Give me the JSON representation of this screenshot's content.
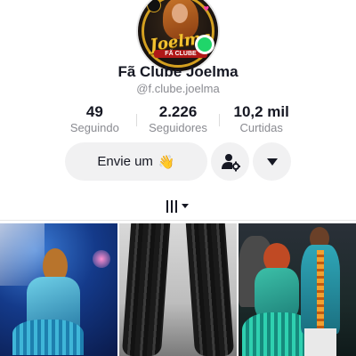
{
  "profile": {
    "avatar_logo_text": "Joelma",
    "avatar_logo_sub": "FÃ CLUBE",
    "name": "Fã Clube Joelma",
    "handle": "@f.clube.joelma",
    "online_color": "#20d56a"
  },
  "stats": [
    {
      "value": "49",
      "label": "Seguindo"
    },
    {
      "value": "2.226",
      "label": "Seguidores"
    },
    {
      "value": "10,2 mil",
      "label": "Curtidas"
    }
  ],
  "actions": {
    "message_label": "Envie um",
    "message_emoji": "👋",
    "friends_icon": "add-friends-icon",
    "more_icon": "chevron-down-icon"
  },
  "tabs": {
    "active_icon": "videos-grid-icon"
  },
  "videos": [
    {
      "thumbnail": "dancer-blue-stage"
    },
    {
      "thumbnail": "black-boots-legs"
    },
    {
      "thumbnail": "dancers-stage-band"
    }
  ]
}
